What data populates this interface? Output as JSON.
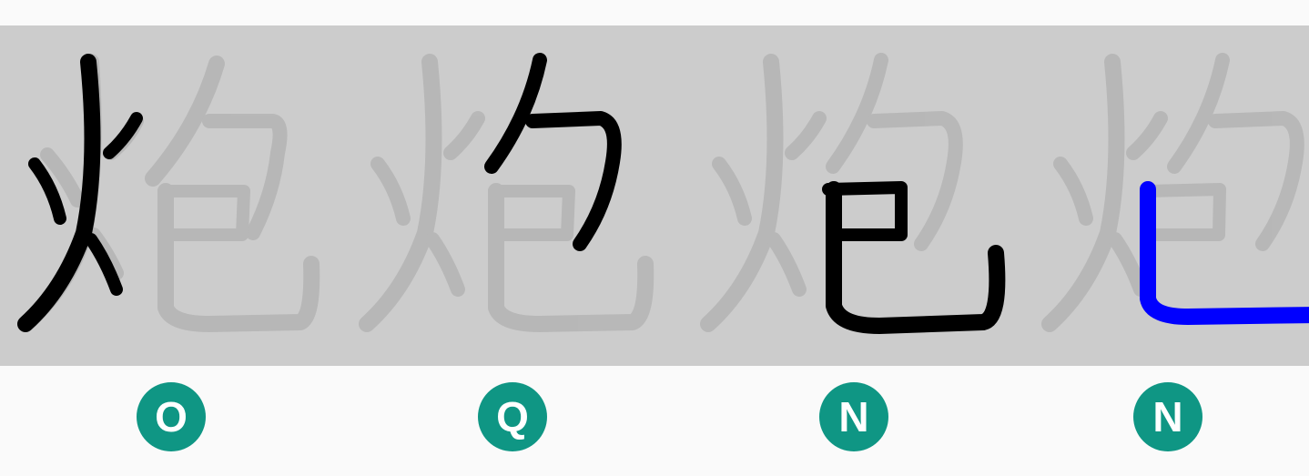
{
  "character": "炮",
  "colors": {
    "strip_background": "#cccccc",
    "ghost_stroke": "#b4b4b4",
    "drawn_stroke": "#000000",
    "active_stroke": "#0000ff",
    "badge_background": "#0f9684",
    "badge_text": "#ffffff",
    "page_background": "#fafafa"
  },
  "stroke_frames": [
    {
      "highlighted_part": "fire-radical",
      "highlight_color": "#000000",
      "grade": "O"
    },
    {
      "highlighted_part": "wrap-hook",
      "highlight_color": "#000000",
      "grade": "Q"
    },
    {
      "highlighted_part": "ba-component",
      "highlight_color": "#000000",
      "grade": "N"
    },
    {
      "highlighted_part": "final-hook",
      "highlight_color": "#0000ff",
      "grade": "N"
    }
  ]
}
